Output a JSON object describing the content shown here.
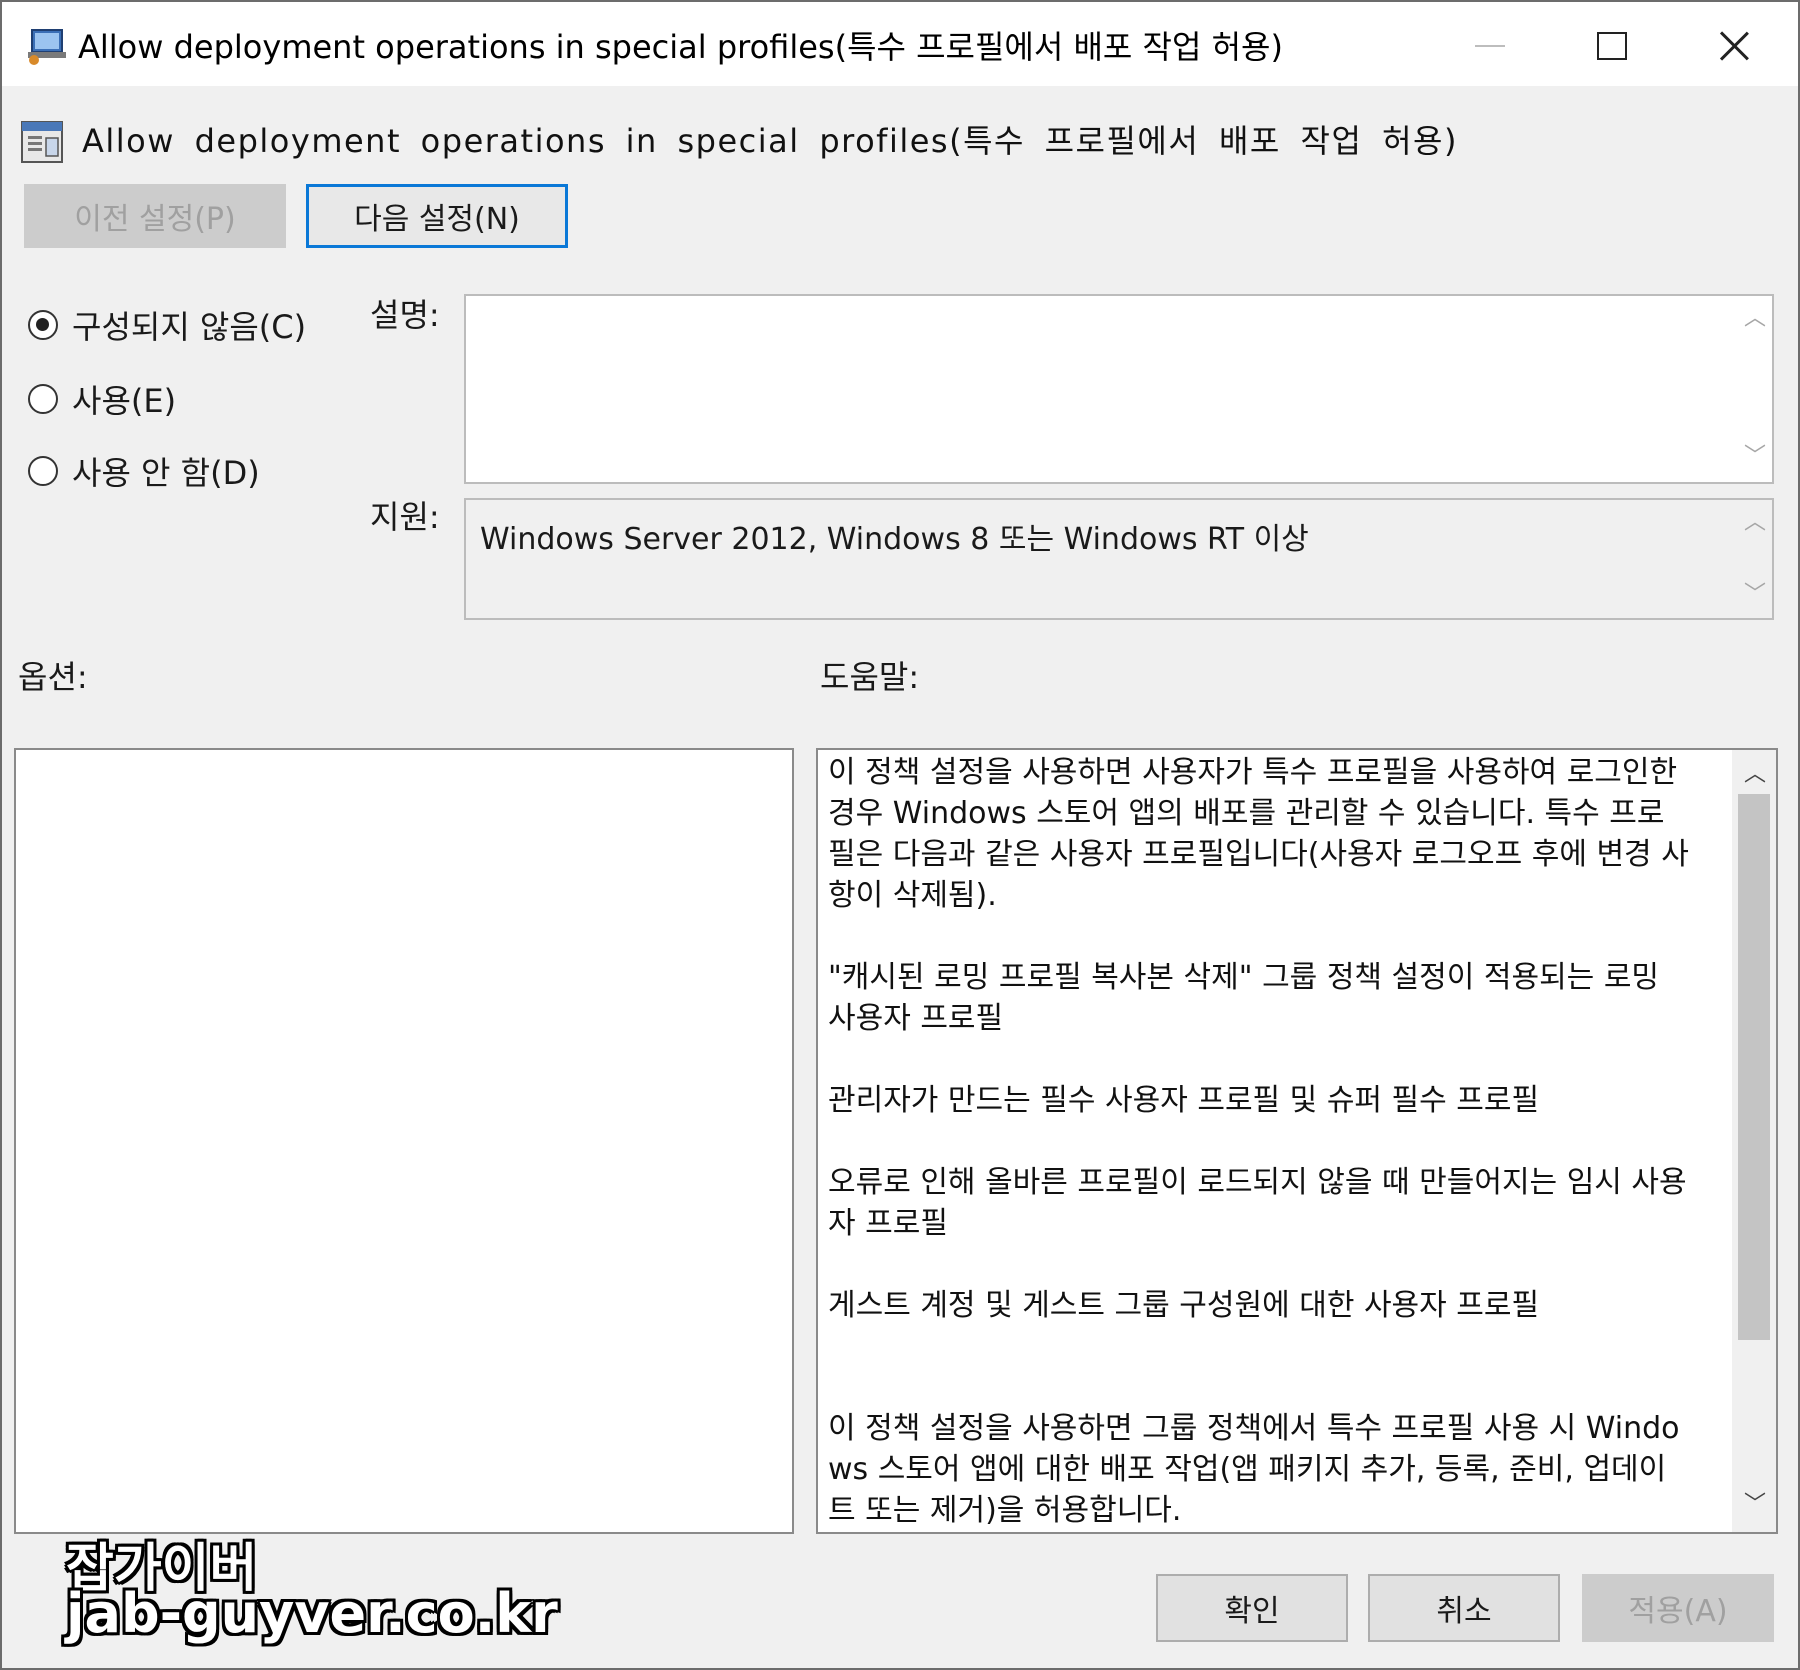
{
  "window": {
    "title": "Allow deployment operations in special profiles(특수 프로필에서 배포 작업 허용)",
    "controls": [
      "minimize-icon",
      "maximize-icon",
      "close-icon"
    ]
  },
  "policy": {
    "name": "Allow deployment operations in special profiles(특수 프로필에서 배포 작업 허용)",
    "prev_label": "이전 설정(P)",
    "next_label": "다음 설정(N)"
  },
  "state": {
    "options": [
      {
        "label": "구성되지 않음(C)",
        "checked": true
      },
      {
        "label": "사용(E)",
        "checked": false
      },
      {
        "label": "사용 안 함(D)",
        "checked": false
      }
    ]
  },
  "description": {
    "label": "설명:",
    "text": ""
  },
  "support": {
    "label": "지원:",
    "text": "Windows Server 2012, Windows 8 또는 Windows RT 이상"
  },
  "sections": {
    "options_label": "옵션:",
    "help_label": "도움말:"
  },
  "help": {
    "text": "이 정책 설정을 사용하면 사용자가 특수 프로필을 사용하여 로그인한 경우 Windows 스토어 앱의 배포를 관리할 수 있습니다. 특수 프로필은 다음과 같은 사용자 프로필입니다(사용자 로그오프 후에 변경 사항이 삭제됨).\n\n\"캐시된 로밍 프로필 복사본 삭제\" 그룹 정책 설정이 적용되는 로밍 사용자 프로필\n\n관리자가 만드는 필수 사용자 프로필 및 슈퍼 필수 프로필\n\n오류로 인해 올바른 프로필이 로드되지 않을 때 만들어지는 임시 사용자 프로필\n\n게스트 계정 및 게스트 그룹 구성원에 대한 사용자 프로필\n\n\n이 정책 설정을 사용하면 그룹 정책에서 특수 프로필 사용 시 Windows 스토어 앱에 대한 배포 작업(앱 패키지 추가, 등록, 준비, 업데이트 또는 제거)을 허용합니다."
  },
  "footer": {
    "ok_label": "확인",
    "cancel_label": "취소",
    "apply_label": "적용(A)"
  },
  "watermark": {
    "line1": "잡가이버",
    "line2": "jab-guyver.co.kr"
  },
  "colors": {
    "accent": "#0a78d7",
    "window_bg": "#f0f0f0",
    "disabled_text": "#a0a0a0"
  }
}
